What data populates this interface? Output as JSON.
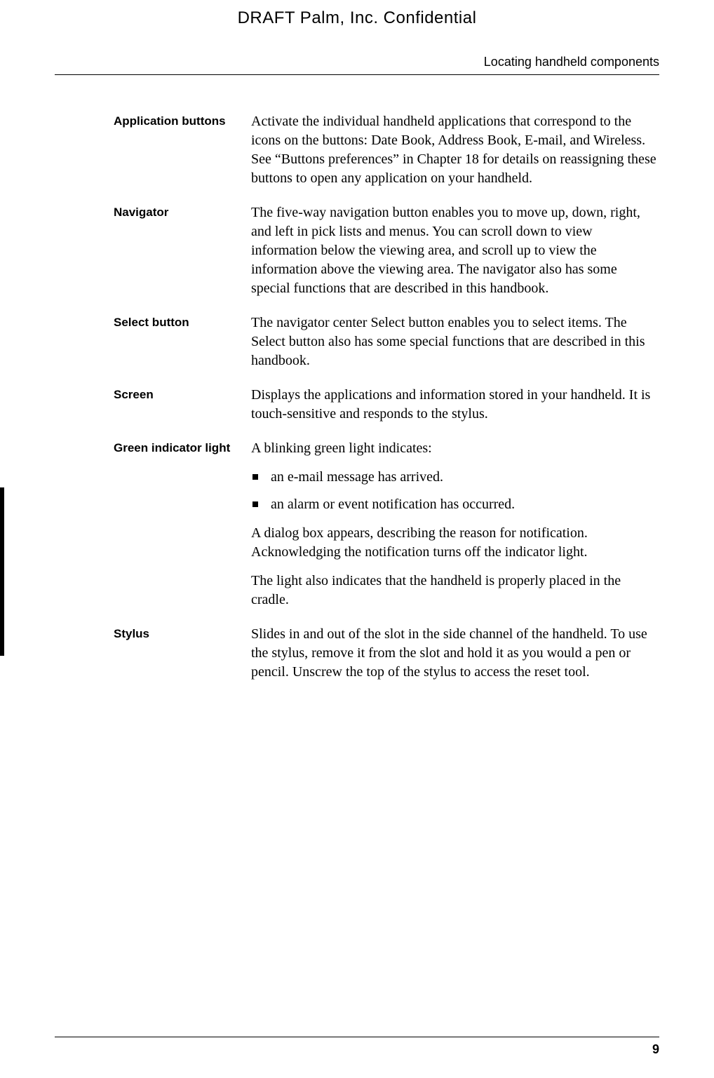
{
  "draft_header": "DRAFT   Palm, Inc. Confidential",
  "section_header": "Locating handheld components",
  "page_number": "9",
  "rows": [
    {
      "term": "Application buttons",
      "paragraphs": [
        "Activate the individual handheld applications that correspond to the icons on the buttons: Date Book, Address Book, E-mail, and Wireless. See “Buttons preferences” in Chapter 18 for details on reassigning these buttons to open any application on your handheld."
      ]
    },
    {
      "term": "Navigator",
      "paragraphs": [
        "The five-way navigation button enables you to move up, down, right, and left in pick lists and menus. You can scroll down to view information below the viewing area, and scroll up to view the information above the viewing area. The navigator also has some special functions that are described in this handbook."
      ]
    },
    {
      "term": "Select button",
      "paragraphs": [
        "The navigator center Select button enables you to select items. The Select button also has some special functions that are described in this handbook."
      ]
    },
    {
      "term": "Screen",
      "paragraphs": [
        "Displays the applications and information stored in your handheld. It is touch-sensitive and responds to the stylus."
      ]
    },
    {
      "term": "Green indicator light",
      "intro": "A blinking green light indicates:",
      "bullets": [
        "an e-mail message has arrived.",
        "an alarm or event notification has occurred."
      ],
      "after_paragraphs": [
        "A dialog box appears, describing the reason for notification. Acknowledging the notification turns off the indicator light.",
        "The light also indicates that the handheld is properly placed in the cradle."
      ]
    },
    {
      "term": "Stylus",
      "paragraphs": [
        "Slides in and out of the slot in the side channel of the handheld. To use the stylus, remove it from the slot and hold it as you would a pen or pencil. Unscrew the top of the stylus to access the reset tool."
      ]
    }
  ]
}
